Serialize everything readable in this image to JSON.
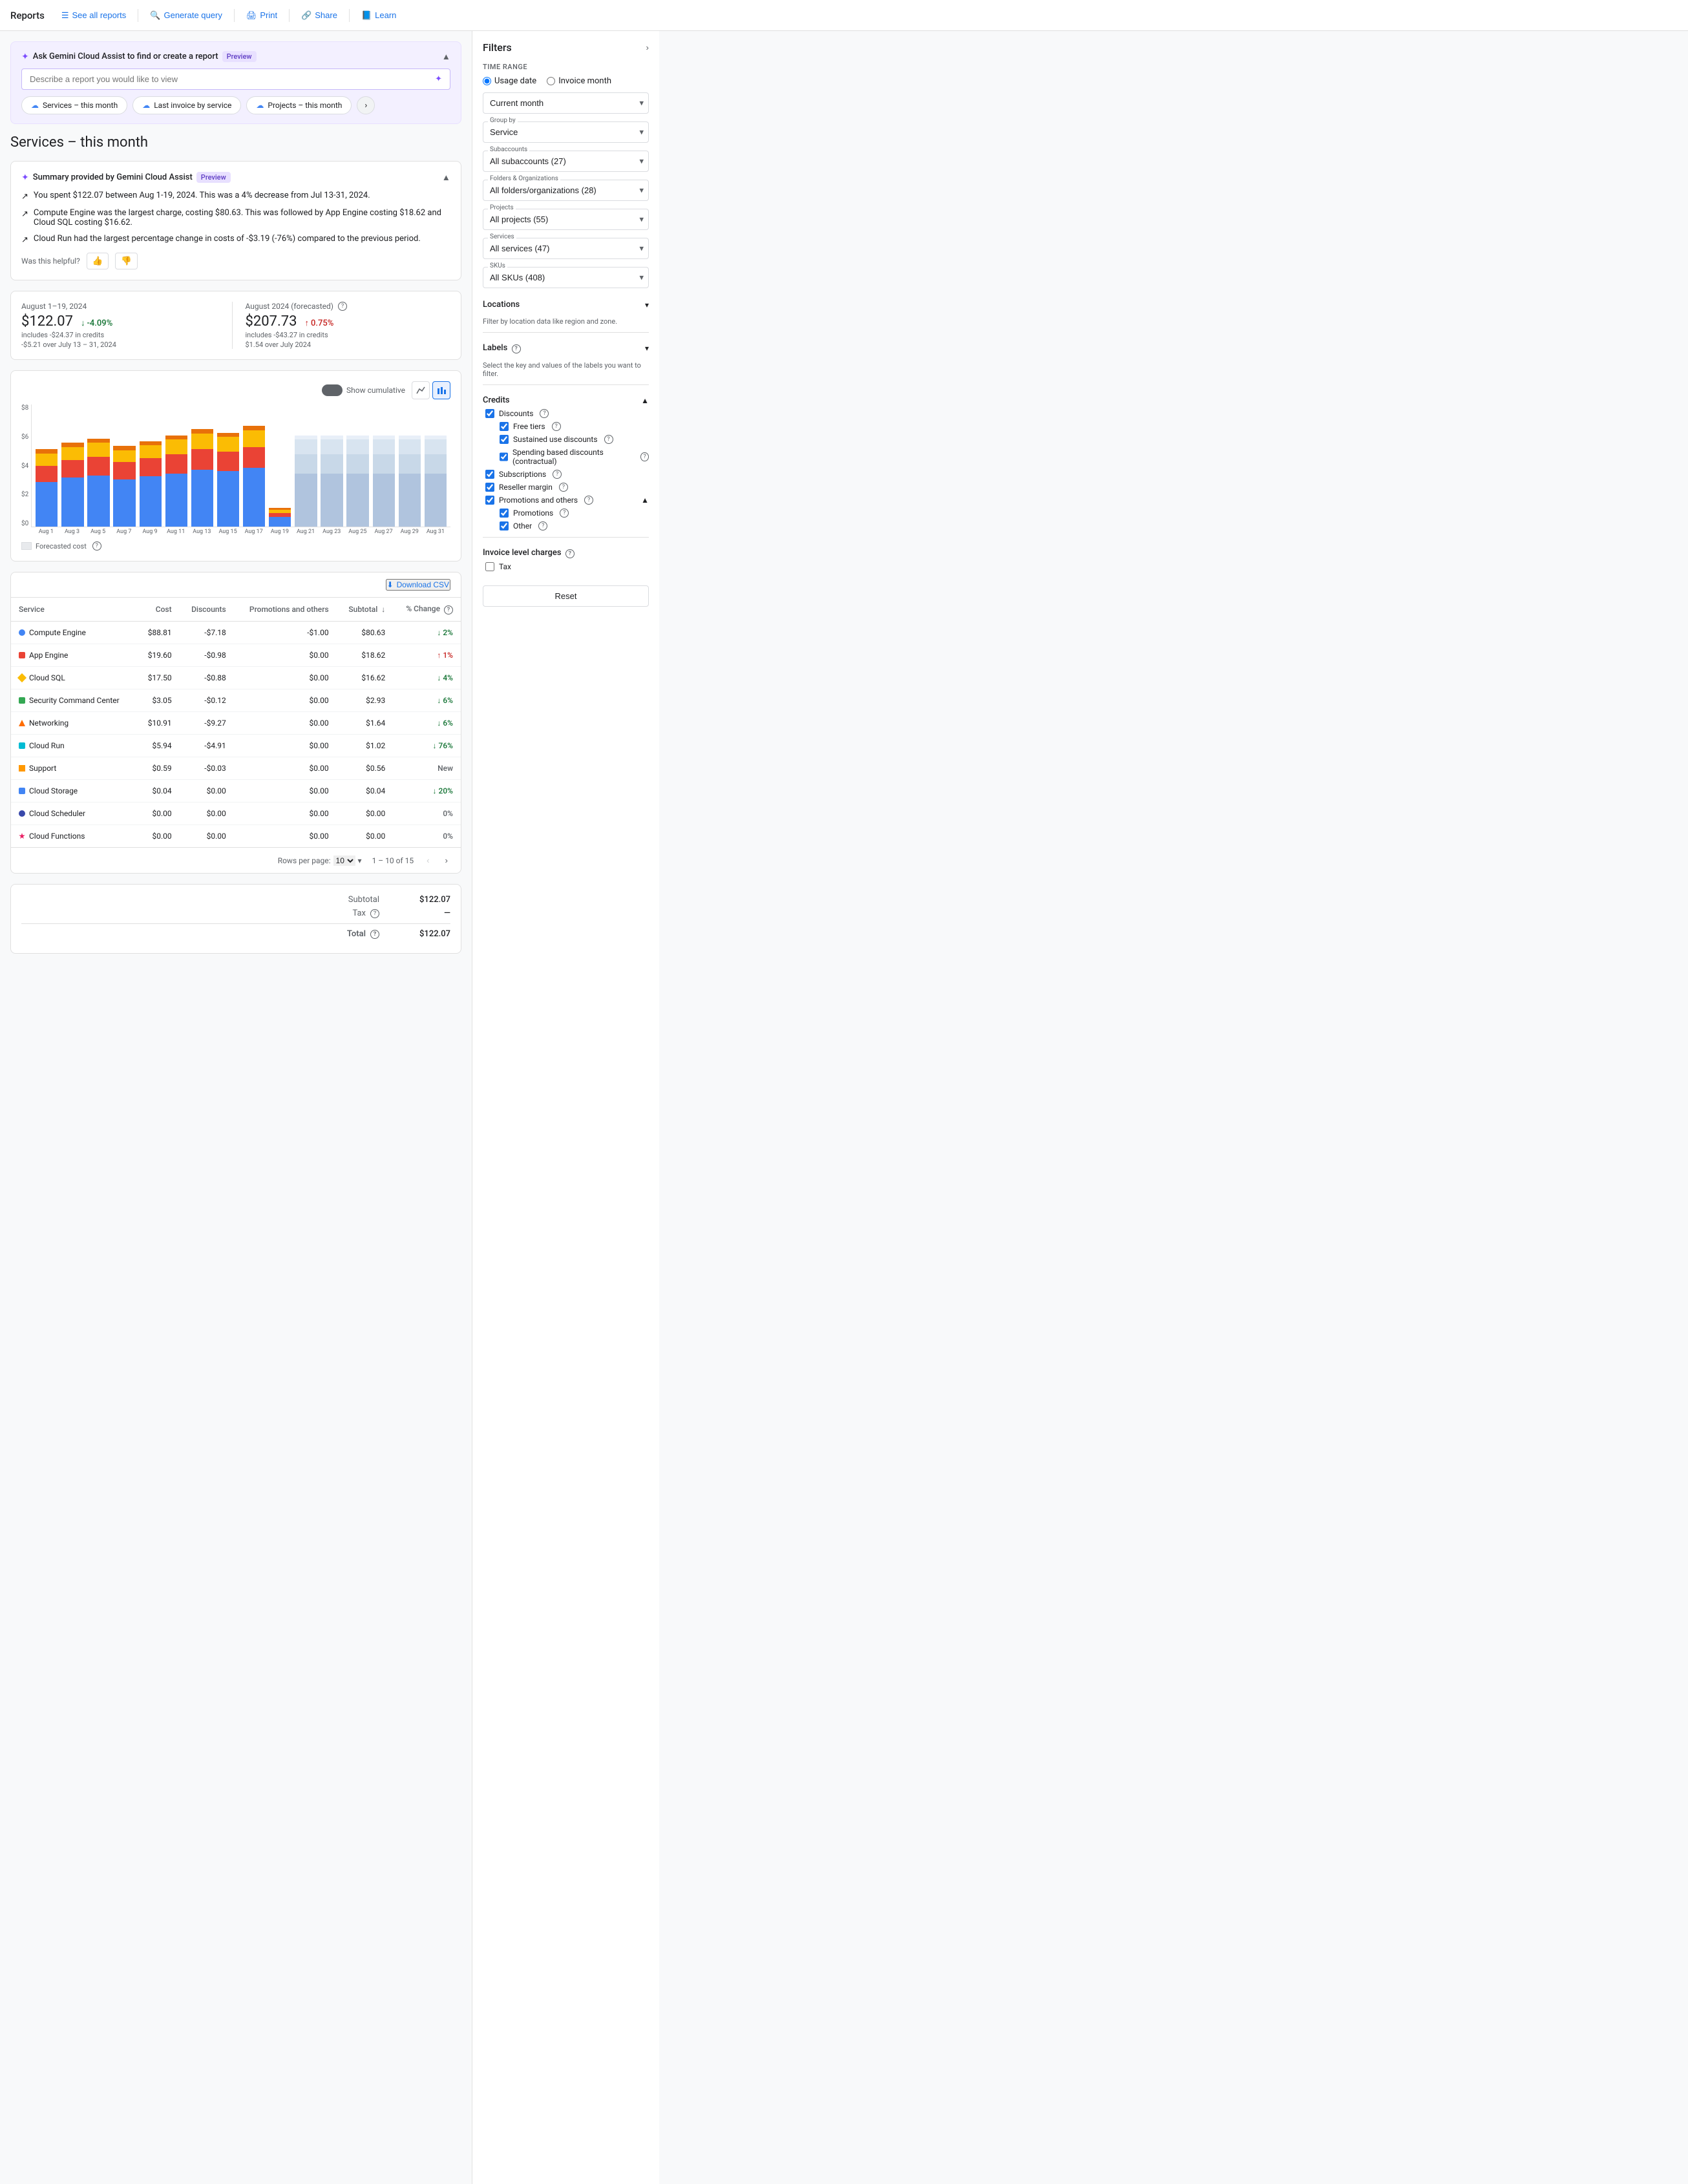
{
  "nav": {
    "title": "Reports",
    "items": [
      {
        "label": "See all reports",
        "icon": "list-icon"
      },
      {
        "label": "Generate query",
        "icon": "search-icon"
      },
      {
        "label": "Print",
        "icon": "print-icon"
      },
      {
        "label": "Share",
        "icon": "share-icon"
      },
      {
        "label": "Learn",
        "icon": "learn-icon"
      }
    ]
  },
  "gemini": {
    "title": "Ask Gemini Cloud Assist to find or create a report",
    "badge": "Preview",
    "placeholder": "Describe a report you would like to view",
    "chips": [
      {
        "label": "Services – this month"
      },
      {
        "label": "Last invoice by service"
      },
      {
        "label": "Projects – this month"
      }
    ]
  },
  "page_title": "Services – this month",
  "summary": {
    "title": "Summary provided by Gemini Cloud Assist",
    "badge": "Preview",
    "lines": [
      "You spent $122.07 between Aug 1-19, 2024. This was a 4% decrease from Jul 13-31, 2024.",
      "Compute Engine was the largest charge, costing $80.63. This was followed by App Engine costing $18.62 and Cloud SQL costing $16.62.",
      "Cloud Run had the largest percentage change in costs of -$3.19 (-76%) compared to the previous period."
    ],
    "helpful_label": "Was this helpful?"
  },
  "stats": {
    "current": {
      "date": "August 1–19, 2024",
      "amount": "$122.07",
      "sub": "includes -$24.37 in credits",
      "change": "-4.09%",
      "change_type": "down",
      "change_detail": "-$5.21 over July 13 – 31, 2024"
    },
    "forecast": {
      "date": "August 2024 (forecasted)",
      "amount": "$207.73",
      "sub": "includes -$43.27 in credits",
      "change": "0.75%",
      "change_type": "up",
      "change_detail": "$1.54 over July 2024"
    }
  },
  "chart": {
    "y_label": "$8",
    "y_labels": [
      "$8",
      "$6",
      "$4",
      "$2",
      "$0"
    ],
    "show_cumulative": "Show cumulative",
    "forecasted_cost": "Forecasted cost",
    "x_labels": [
      "Aug 1",
      "Aug 3",
      "Aug 5",
      "Aug 7",
      "Aug 9",
      "Aug 11",
      "Aug 13",
      "Aug 15",
      "Aug 17",
      "Aug 19",
      "Aug 21",
      "Aug 23",
      "Aug 25",
      "Aug 27",
      "Aug 29",
      "Aug 31"
    ],
    "bars": [
      {
        "h1": 55,
        "h2": 20,
        "h3": 15,
        "h4": 5,
        "forecasted": false
      },
      {
        "h1": 60,
        "h2": 22,
        "h3": 16,
        "h4": 5,
        "forecasted": false
      },
      {
        "h1": 63,
        "h2": 23,
        "h3": 17,
        "h4": 5,
        "forecasted": false
      },
      {
        "h1": 58,
        "h2": 21,
        "h3": 15,
        "h4": 5,
        "forecasted": false
      },
      {
        "h1": 62,
        "h2": 22,
        "h3": 16,
        "h4": 5,
        "forecasted": false
      },
      {
        "h1": 65,
        "h2": 24,
        "h3": 18,
        "h4": 5,
        "forecasted": false
      },
      {
        "h1": 70,
        "h2": 25,
        "h3": 19,
        "h4": 6,
        "forecasted": false
      },
      {
        "h1": 68,
        "h2": 24,
        "h3": 18,
        "h4": 5,
        "forecasted": false
      },
      {
        "h1": 72,
        "h2": 26,
        "h3": 20,
        "h4": 6,
        "forecasted": false
      },
      {
        "h1": 12,
        "h2": 5,
        "h3": 4,
        "h4": 2,
        "forecasted": false
      },
      {
        "h1": 65,
        "h2": 24,
        "h3": 18,
        "h4": 5,
        "forecasted": true
      },
      {
        "h1": 65,
        "h2": 24,
        "h3": 18,
        "h4": 5,
        "forecasted": true
      },
      {
        "h1": 65,
        "h2": 24,
        "h3": 18,
        "h4": 5,
        "forecasted": true
      },
      {
        "h1": 65,
        "h2": 24,
        "h3": 18,
        "h4": 5,
        "forecasted": true
      },
      {
        "h1": 65,
        "h2": 24,
        "h3": 18,
        "h4": 5,
        "forecasted": true
      },
      {
        "h1": 65,
        "h2": 24,
        "h3": 18,
        "h4": 5,
        "forecasted": true
      }
    ]
  },
  "table": {
    "download_label": "Download CSV",
    "headers": [
      "Service",
      "Cost",
      "Discounts",
      "Promotions and others",
      "Subtotal",
      "% Change"
    ],
    "rows": [
      {
        "service": "Compute Engine",
        "dot": "dot-blue",
        "cost": "$88.81",
        "discounts": "-$7.18",
        "promo": "-$1.00",
        "subtotal": "$80.63",
        "change": "↓ 2%",
        "change_type": "down"
      },
      {
        "service": "App Engine",
        "dot": "dot-red",
        "cost": "$19.60",
        "discounts": "-$0.98",
        "promo": "$0.00",
        "subtotal": "$18.62",
        "change": "↑ 1%",
        "change_type": "up"
      },
      {
        "service": "Cloud SQL",
        "dot": "dot-yellow",
        "cost": "$17.50",
        "discounts": "-$0.88",
        "promo": "$0.00",
        "subtotal": "$16.62",
        "change": "↓ 4%",
        "change_type": "down"
      },
      {
        "service": "Security Command Center",
        "dot": "dot-teal",
        "cost": "$3.05",
        "discounts": "-$0.12",
        "promo": "$0.00",
        "subtotal": "$2.93",
        "change": "↓ 6%",
        "change_type": "down"
      },
      {
        "service": "Networking",
        "dot": "dot-orange-tri",
        "cost": "$10.91",
        "discounts": "-$9.27",
        "promo": "$0.00",
        "subtotal": "$1.64",
        "change": "↓ 6%",
        "change_type": "down"
      },
      {
        "service": "Cloud Run",
        "dot": "dot-teal-sq",
        "cost": "$5.94",
        "discounts": "-$4.91",
        "promo": "$0.00",
        "subtotal": "$1.02",
        "change": "↓ 76%",
        "change_type": "down"
      },
      {
        "service": "Support",
        "dot": "dot-orange-star",
        "cost": "$0.59",
        "discounts": "-$0.03",
        "promo": "$0.00",
        "subtotal": "$0.56",
        "change": "New",
        "change_type": "neutral"
      },
      {
        "service": "Cloud Storage",
        "dot": "dot-blue-sq",
        "cost": "$0.04",
        "discounts": "$0.00",
        "promo": "$0.00",
        "subtotal": "$0.04",
        "change": "↓ 20%",
        "change_type": "down"
      },
      {
        "service": "Cloud Scheduler",
        "dot": "dot-navy",
        "cost": "$0.00",
        "discounts": "$0.00",
        "promo": "$0.00",
        "subtotal": "$0.00",
        "change": "0%",
        "change_type": "neutral"
      },
      {
        "service": "Cloud Functions",
        "dot": "dot-pink",
        "cost": "$0.00",
        "discounts": "$0.00",
        "promo": "$0.00",
        "subtotal": "$0.00",
        "change": "0%",
        "change_type": "neutral"
      }
    ],
    "pagination": {
      "rows_per_page": "10",
      "current_range": "1 – 10 of 15"
    }
  },
  "totals": {
    "subtotal_label": "Subtotal",
    "subtotal_value": "$122.07",
    "tax_label": "Tax",
    "tax_value": "—",
    "total_label": "Total",
    "total_value": "$122.07"
  },
  "filters": {
    "title": "Filters",
    "time_range_label": "Time range",
    "usage_date_label": "Usage date",
    "invoice_month_label": "Invoice month",
    "current_month_label": "Current month",
    "group_by_label": "Group by",
    "group_by_value": "Service",
    "subaccounts_label": "Subaccounts",
    "subaccounts_value": "All subaccounts (27)",
    "folders_label": "Folders & Organizations",
    "folders_value": "All folders/organizations (28)",
    "projects_label": "Projects",
    "projects_value": "All projects (55)",
    "services_label": "Services",
    "services_value": "All services (47)",
    "skus_label": "SKUs",
    "skus_value": "All SKUs (408)",
    "locations_label": "Locations",
    "locations_note": "Filter by location data like region and zone.",
    "labels_label": "Labels",
    "labels_note": "Select the key and values of the labels you want to filter.",
    "credits_label": "Credits",
    "discounts_label": "Discounts",
    "free_tiers_label": "Free tiers",
    "sustained_use_label": "Sustained use discounts",
    "spending_based_label": "Spending based discounts (contractual)",
    "subscriptions_label": "Subscriptions",
    "reseller_label": "Reseller margin",
    "promotions_others_label": "Promotions and others",
    "promotions_label": "Promotions",
    "other_label": "Other",
    "invoice_charges_label": "Invoice level charges",
    "tax_label": "Tax",
    "reset_label": "Reset"
  }
}
